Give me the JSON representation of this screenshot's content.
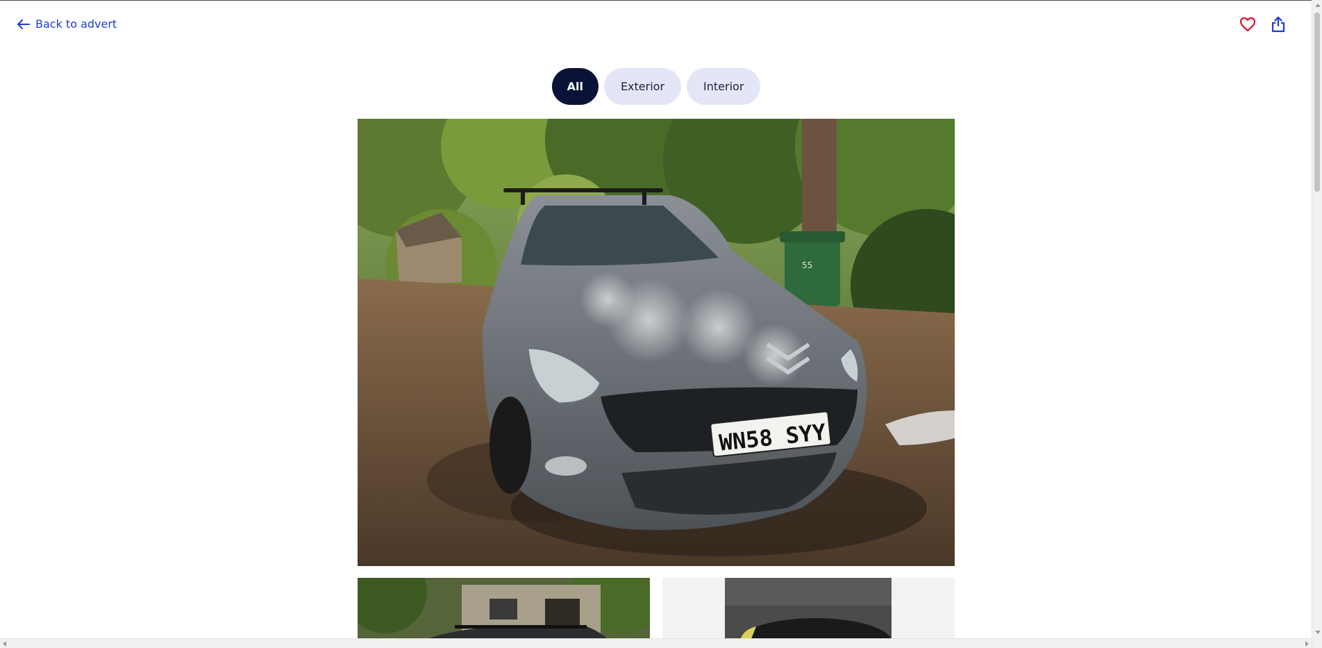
{
  "header": {
    "back_label": "Back to advert",
    "icons": [
      "arrow-left-icon",
      "heart-icon",
      "share-icon"
    ],
    "colors": {
      "link": "#1f3ad6",
      "heart": "#e0102a",
      "share": "#1f3ad6"
    }
  },
  "filters": {
    "items": [
      {
        "label": "All",
        "active": true
      },
      {
        "label": "Exterior",
        "active": false
      },
      {
        "label": "Interior",
        "active": false
      }
    ],
    "colors": {
      "active_bg": "#0b1238",
      "inactive_bg": "#e3e6f7"
    }
  },
  "gallery": {
    "main_photo": {
      "subject": "grey estate car parked on driveway under trees",
      "plate_text": "WN58 SYY",
      "bin_text": "55"
    },
    "thumbnails": [
      {
        "subject": "car roof rack in front of stone cottage"
      },
      {
        "subject": "close-up interior detail, dark"
      }
    ]
  }
}
